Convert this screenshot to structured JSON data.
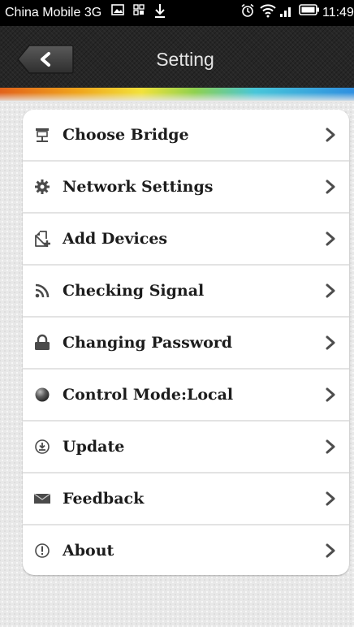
{
  "status_bar": {
    "carrier": "China Mobile 3G",
    "time": "11:49",
    "icons": [
      "image-icon",
      "qr-icon",
      "download-icon",
      "alarm-icon",
      "wifi-icon",
      "signal-icon",
      "battery-icon"
    ]
  },
  "header": {
    "title": "Setting",
    "back_icon": "chevron-left-icon"
  },
  "menu": {
    "items": [
      {
        "label": "Choose Bridge",
        "icon": "bridge-icon"
      },
      {
        "label": "Network Settings",
        "icon": "gear-icon"
      },
      {
        "label": "Add Devices",
        "icon": "add-device-icon"
      },
      {
        "label": "Checking Signal",
        "icon": "signal-icon"
      },
      {
        "label": "Changing Password",
        "icon": "lock-icon"
      },
      {
        "label": "Control Mode:Local",
        "icon": "globe-icon"
      },
      {
        "label": "Update",
        "icon": "update-icon"
      },
      {
        "label": "Feedback",
        "icon": "mail-icon"
      },
      {
        "label": "About",
        "icon": "info-icon"
      }
    ]
  },
  "colors": {
    "header_bg": "#262626",
    "card_bg": "#ffffff",
    "icon_color": "#4a4a4a",
    "chevron_color": "#4d4d4d"
  }
}
